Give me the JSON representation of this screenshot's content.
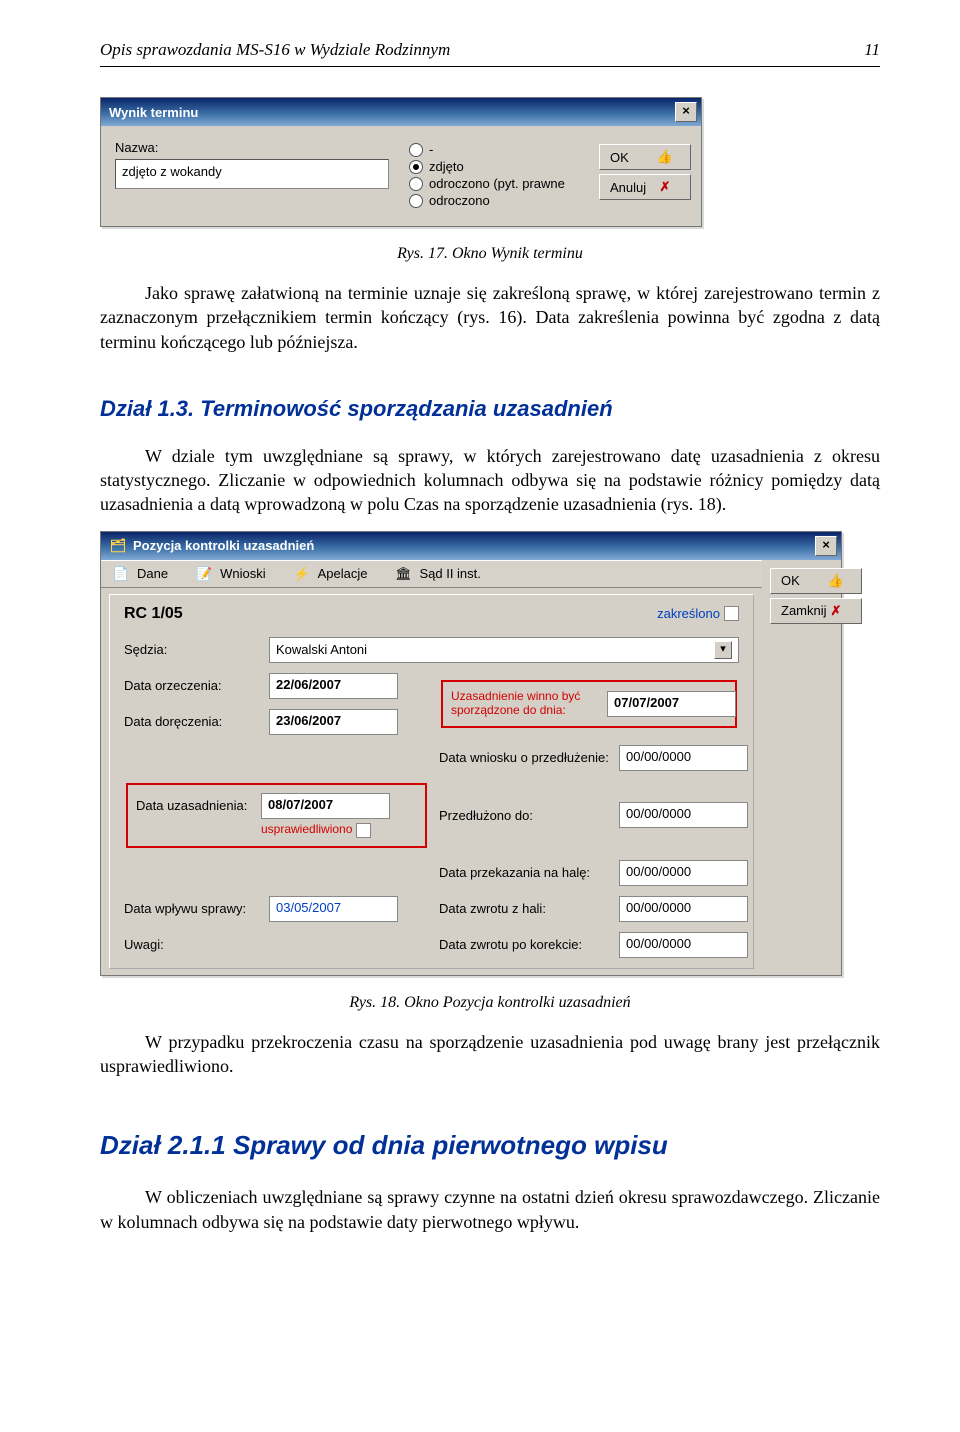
{
  "header": {
    "title": "Opis sprawozdania MS-S16 w Wydziale Rodzinnym",
    "page": "11"
  },
  "fig17": {
    "caption": "Rys. 17. Okno Wynik terminu",
    "title": "Wynik terminu",
    "nazwa_label": "Nazwa:",
    "nazwa_value": "zdjęto z wokandy",
    "radios": {
      "r0": "-",
      "r1": "zdjęto",
      "r2": "odroczono (pyt. prawne",
      "r3": "odroczono"
    },
    "ok_label": "OK",
    "cancel_label": "Anuluj"
  },
  "p1": "Jako sprawę załatwioną na terminie uznaje się zakreśloną sprawę, w której zarejestrowano termin z zaznaczonym przełącznikiem termin kończący (rys. 16). Data zakreślenia powinna być zgodna z datą terminu kończącego lub późniejsza.",
  "s13": {
    "title": "Dział 1.3. Terminowość sporządzania uzasadnień",
    "p": "W dziale tym uwzględniane są sprawy, w których zarejestrowano datę uzasadnienia z okresu statystycznego. Zliczanie w odpowiednich kolumnach odbywa się na podstawie różnicy pomiędzy datą uzasadnienia a datą wprowadzoną  w polu Czas na sporządzenie uzasadnienia (rys. 18)."
  },
  "fig18": {
    "caption": "Rys. 18. Okno Pozycja kontrolki uzasadnień",
    "title": "Pozycja kontrolki uzasadnień",
    "tools": {
      "dane": "Dane",
      "wnioski": "Wnioski",
      "apelacje": "Apelacje",
      "sad": "Sąd II inst."
    },
    "ok_label": "OK",
    "close_label": "Zamknij",
    "rc": "RC  1/05",
    "zakr_label": "zakreślono",
    "rows": {
      "sedzia_label": "Sędzia:",
      "sedzia_value": "Kowalski Antoni",
      "data_orz_label": "Data orzeczenia:",
      "data_orz_value": "22/06/2007",
      "uz_label1": "Uzasadnienie winno być",
      "uz_label2": "sporządzone do dnia:",
      "uz_value": "07/07/2007",
      "data_dor_label": "Data doręczenia:",
      "data_dor_value": "23/06/2007",
      "wniosek_label": "Data wniosku o przedłużenie:",
      "przedl_label": "Przedłużono do:",
      "data_uz_label": "Data uzasadnienia:",
      "data_uz_value": "08/07/2007",
      "uspr_label": "usprawiedliwiono",
      "przek_label": "Data przekazania na halę:",
      "data_wpl_label": "Data wpływu sprawy:",
      "data_wpl_value": "03/05/2007",
      "zwrot_label": "Data zwrotu z hali:",
      "uwagi_label": "Uwagi:",
      "zwrot_kor_label": "Data zwrotu po korekcie:",
      "zeros": "00/00/0000"
    }
  },
  "p2": "W przypadku przekroczenia czasu na sporządzenie uzasadnienia pod uwagę brany jest przełącznik usprawiedliwiono.",
  "s211": {
    "title": "Dział 2.1.1 Sprawy od dnia pierwotnego wpisu",
    "p": "W obliczeniach uwzględniane są sprawy czynne na ostatni dzień okresu sprawozdawczego. Zliczanie w kolumnach odbywa się na podstawie daty pierwotnego wpływu."
  }
}
